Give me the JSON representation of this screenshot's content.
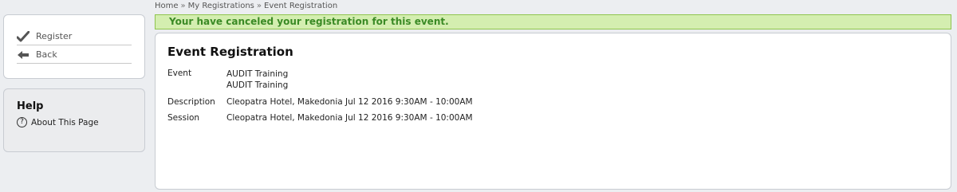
{
  "breadcrumb": {
    "items": [
      "Home",
      "My Registrations",
      "Event Registration"
    ],
    "separator": "»"
  },
  "actions": {
    "register_label": "Register",
    "back_label": "Back"
  },
  "help": {
    "title": "Help",
    "about_label": "About This Page"
  },
  "alert": {
    "message": "Your have canceled your registration for this event."
  },
  "main": {
    "title": "Event Registration",
    "event_label": "Event",
    "event_values": [
      "AUDIT Training",
      "AUDIT Training"
    ],
    "description_label": "Description",
    "description_value": "Cleopatra Hotel, Makedonia Jul 12 2016 9:30AM - 10:00AM",
    "session_label": "Session",
    "session_value": "Cleopatra Hotel, Makedonia Jul 12 2016 9:30AM - 10:00AM"
  },
  "colors": {
    "alert_bg": "#d4eeb0",
    "alert_border": "#8fc44e",
    "alert_text": "#3a8a25"
  },
  "icons": [
    "checkmark-icon",
    "arrow-left-icon",
    "help-question-icon"
  ]
}
